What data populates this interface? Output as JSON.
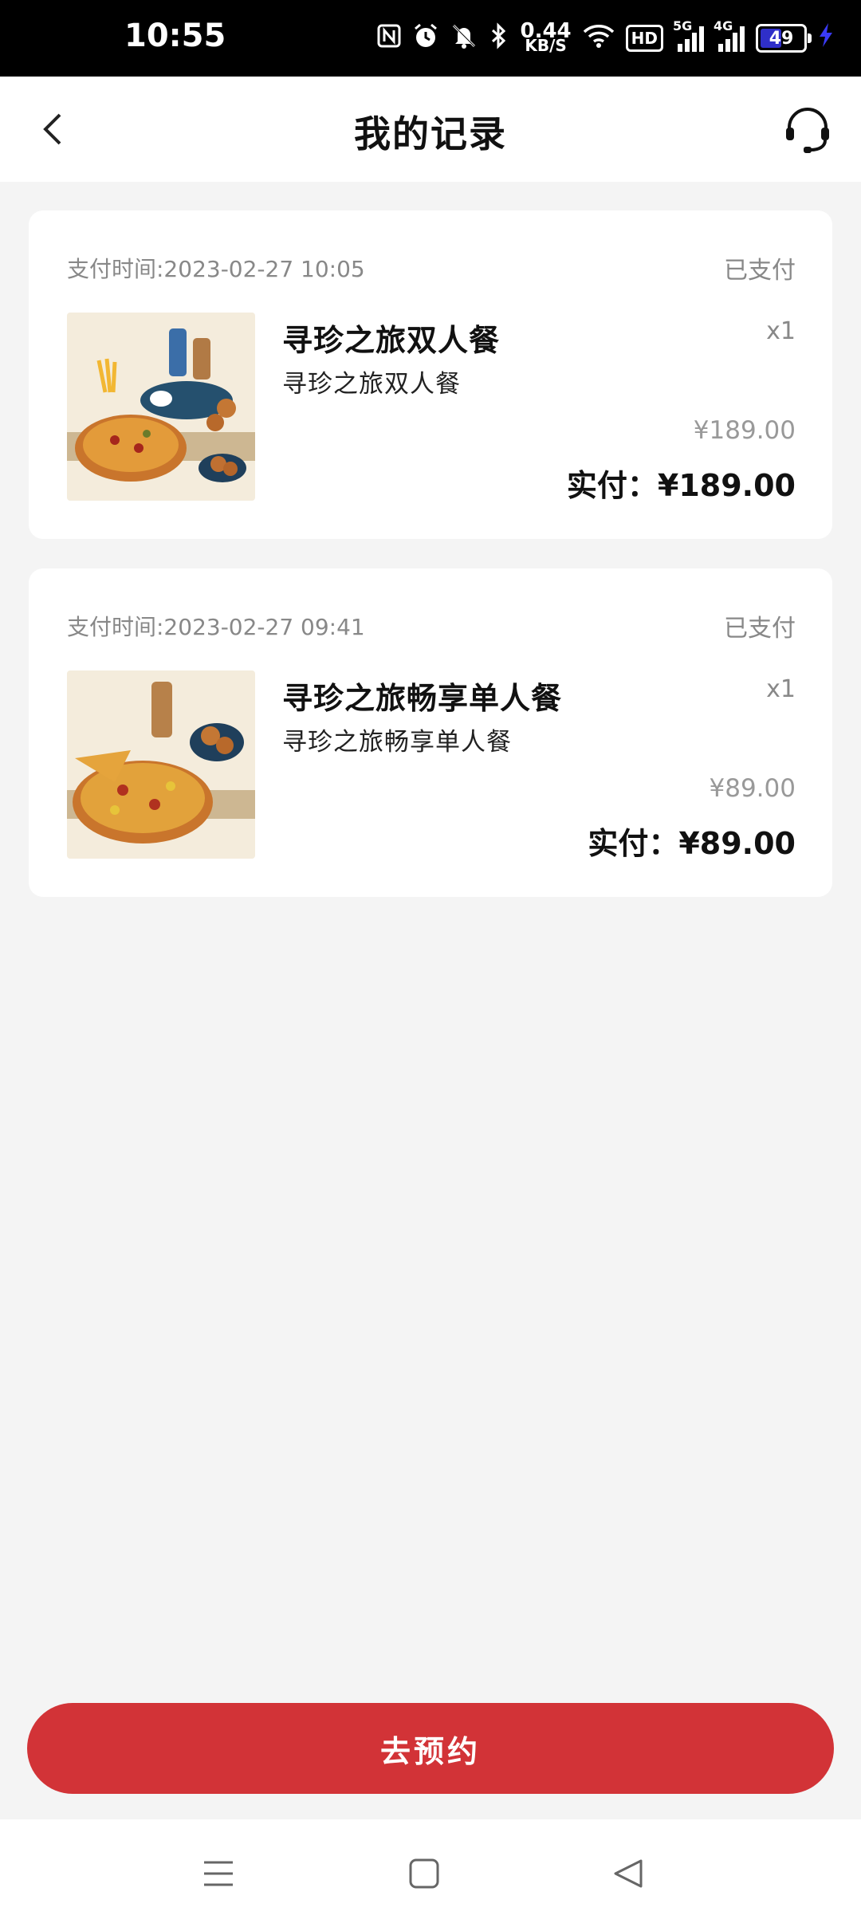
{
  "status_bar": {
    "time": "10:55",
    "net_speed_value": "0.44",
    "net_speed_unit": "KB/S",
    "hd_label": "HD",
    "signal1_label": "5G",
    "signal2_label": "4G",
    "battery_level": "49",
    "icons": [
      "nfc-icon",
      "alarm-icon",
      "mute-icon",
      "bluetooth-icon",
      "wifi-icon",
      "charging-icon"
    ]
  },
  "header": {
    "title": "我的记录",
    "icons": [
      "back-arrow-icon",
      "customer-service-icon"
    ]
  },
  "orders": [
    {
      "pay_time": "支付时间:2023-02-27 10:05",
      "status": "已支付",
      "name": "寻珍之旅双人餐",
      "subtitle": "寻珍之旅双人餐",
      "quantity": "x1",
      "original_price": "¥189.00",
      "paid": "实付：¥189.00"
    },
    {
      "pay_time": "支付时间:2023-02-27 09:41",
      "status": "已支付",
      "name": "寻珍之旅畅享单人餐",
      "subtitle": "寻珍之旅畅享单人餐",
      "quantity": "x1",
      "original_price": "¥89.00",
      "paid": "实付：¥89.00"
    }
  ],
  "footer": {
    "button_label": "去预约",
    "button_color": "#d23337"
  },
  "nav_bar": {
    "icons": [
      "menu-icon",
      "home-icon",
      "back-icon"
    ]
  }
}
